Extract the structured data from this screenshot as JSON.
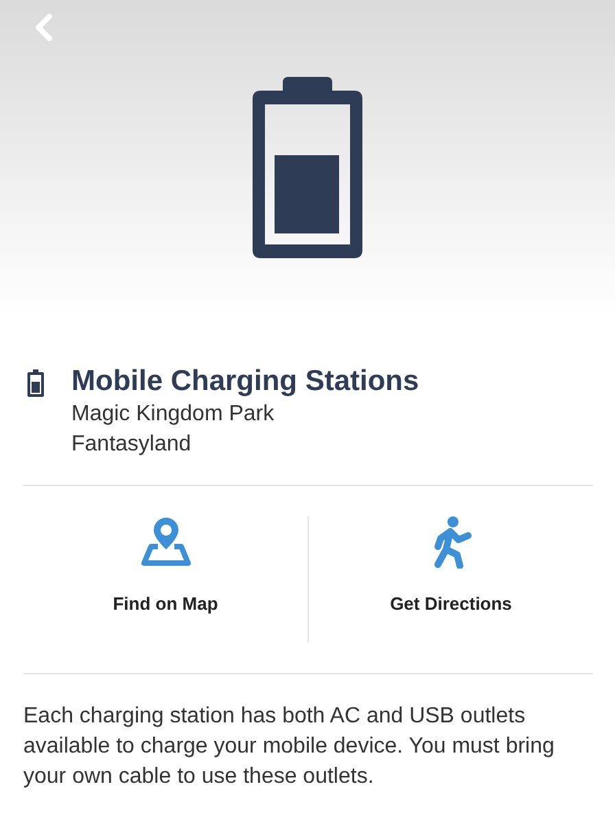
{
  "title": "Mobile Charging Stations",
  "location": [
    "Magic Kingdom Park",
    "Fantasyland"
  ],
  "actions": [
    {
      "kind": "map",
      "label": "Find on Map"
    },
    {
      "kind": "walk",
      "label": "Get Directions"
    }
  ],
  "description": "Each charging station has both AC and USB outlets available to charge your mobile device. You must bring your own cable to use these outlets."
}
